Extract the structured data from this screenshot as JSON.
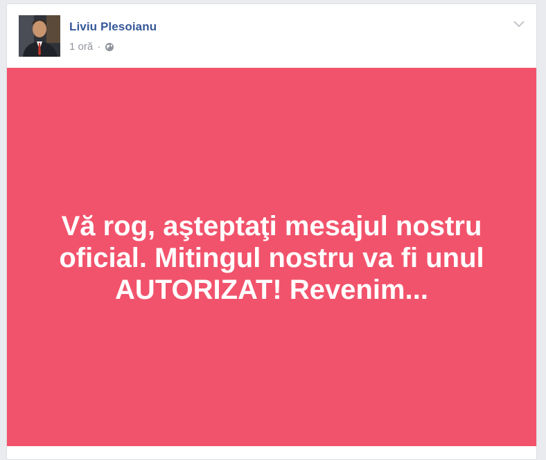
{
  "post": {
    "author_name": "Liviu Plesoianu",
    "timestamp": "1 oră",
    "separator": "·",
    "privacy_icon": "globe-icon",
    "options_icon": "chevron-down-icon",
    "banner_text": "Vă rog, aşteptaţi mesajul nostru oficial. Mitingul nostru va fi unul AUTORIZAT! Revenim...",
    "banner_color": "#f2536c",
    "author_color": "#365899"
  }
}
